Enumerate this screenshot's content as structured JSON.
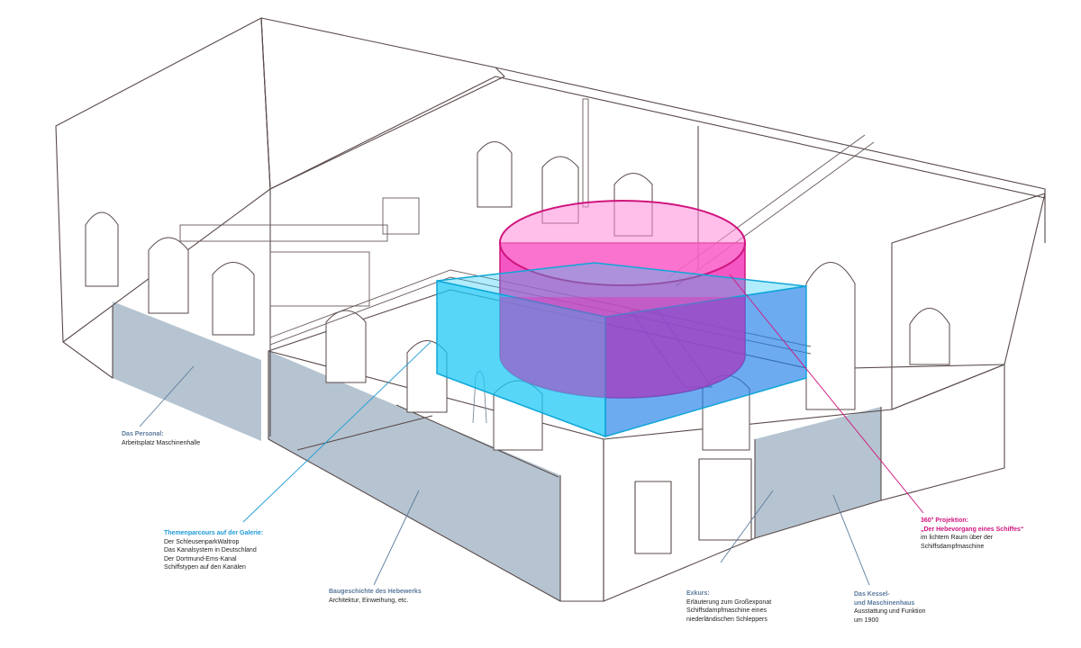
{
  "colors": {
    "line": "#5a4a4a",
    "floor": "#b5c4d0",
    "cyan": "#1fc8f5",
    "magenta": "#f01fb0",
    "label_blue": "#5b7a9d",
    "label_cyan": "#1d9ad6",
    "label_magenta": "#d0157e"
  },
  "annotations": [
    {
      "id": "personal",
      "title": "Das Personal:",
      "lines": [
        "Arbeitsplatz Maschinenhalle"
      ]
    },
    {
      "id": "galerie",
      "title": "Themenparcours auf der Galerie:",
      "lines": [
        "Der SchleusenparkWaltrop",
        "Das Kanalsystem in Deutschland",
        "Der Dortmund-Ems-Kanal",
        "Schiffstypen auf den Kanälen"
      ]
    },
    {
      "id": "baugeschichte",
      "title": "Baugeschichte des Hebewerks",
      "lines": [
        "Architektur, Einweihung, etc."
      ]
    },
    {
      "id": "exkurs",
      "title": "Exkurs:",
      "lines": [
        "Erläuterung zum Großexponat",
        "Schiffsdampfmaschine eines",
        "niederländischen Schleppers"
      ]
    },
    {
      "id": "kessel",
      "title": "Das Kessel-",
      "title2": "und Maschinenhaus",
      "lines": [
        "Ausstattung und Funktion",
        "um 1900"
      ]
    },
    {
      "id": "projektion",
      "title": "360° Projektion:",
      "title2": "„Der Hebevorgang eines Schiffes“",
      "lines": [
        "im lichtem Raum über der",
        "Schiffsdampfmaschine"
      ]
    }
  ]
}
